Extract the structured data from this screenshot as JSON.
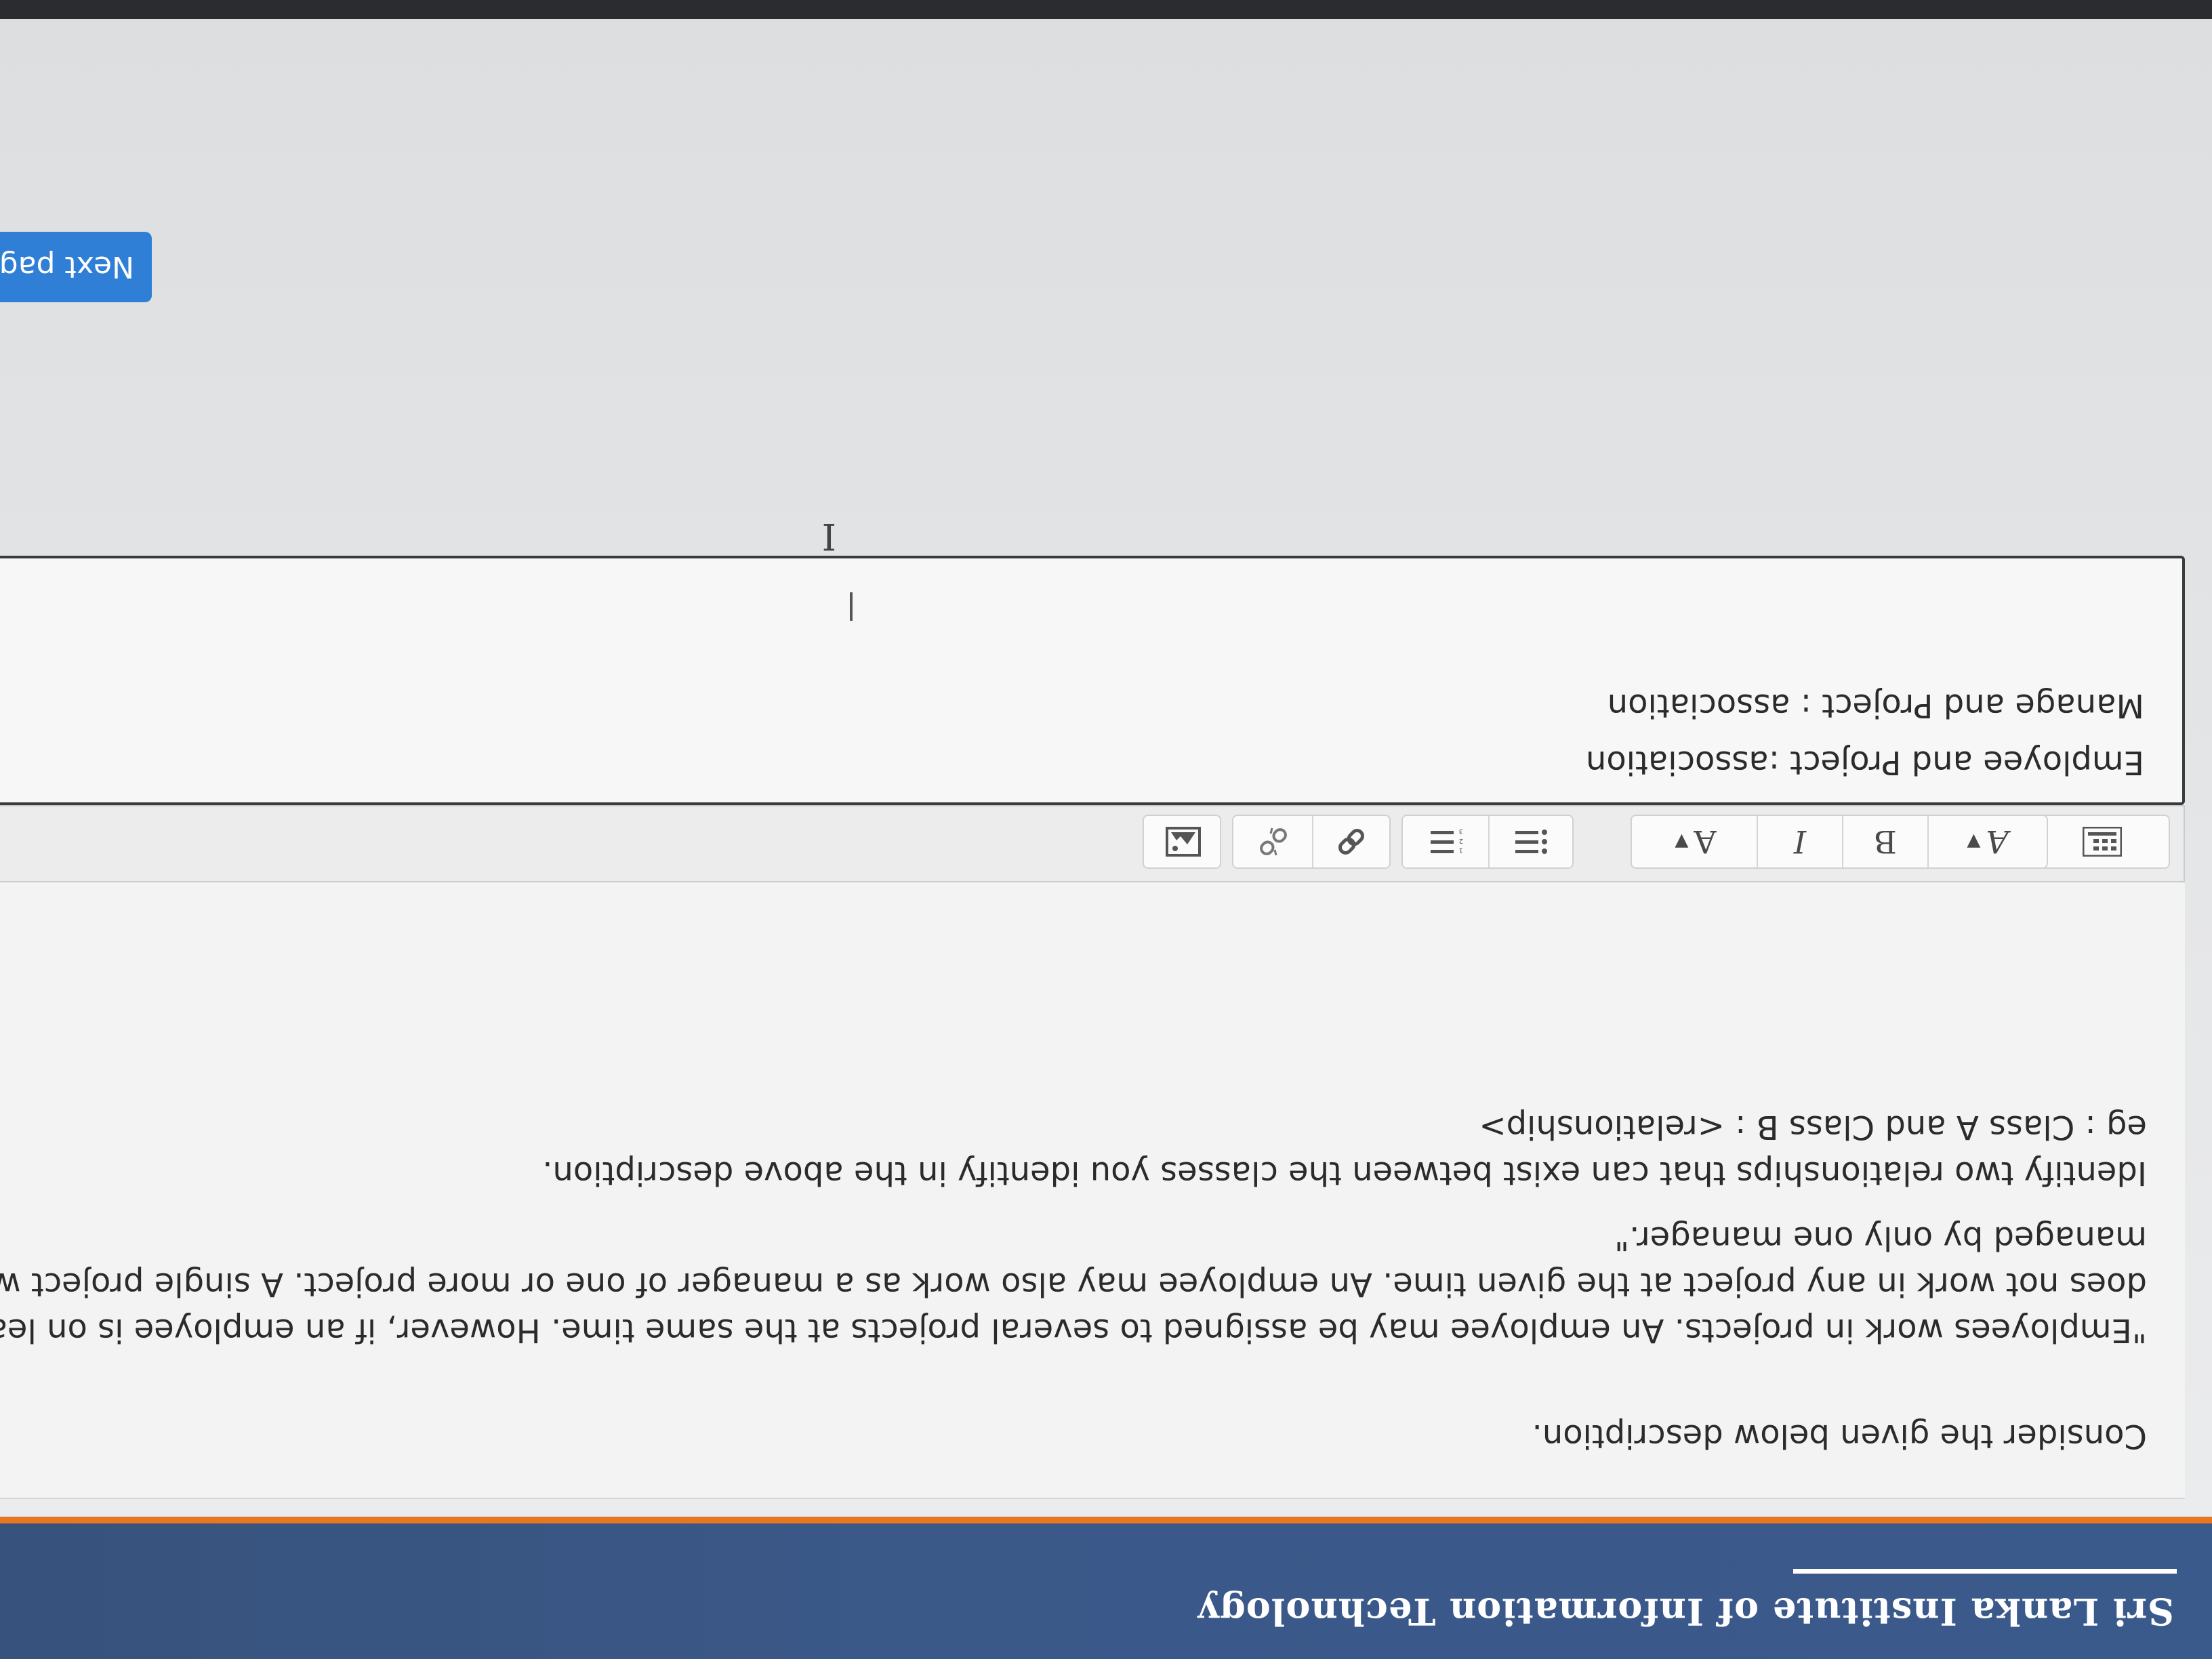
{
  "header": {
    "title": "Sri Lanka Institute of Information Technology"
  },
  "question": {
    "intro": "Consider the given below description.",
    "description_lines": [
      "\"Employees work in projects. An employee may be assigned to several projects at the same time. However, if an employee is on leave,",
      "does not work in any project at the given time. An employee may also work as a manager of one or more project. A single project will b",
      "managed by only one manager.\""
    ],
    "prompt": "Identify two relationships that can exist between the classes you identify in the above description.",
    "example": "eg :  Class A and Class B :  <relationship>"
  },
  "toolbar": {
    "paragraph_style": "A",
    "bold": "B",
    "italic": "I",
    "font_color": "A",
    "icons": [
      "paragraph-style-icon",
      "bold-icon",
      "italic-icon",
      "font-color-icon",
      "bullet-list-icon",
      "numbered-list-icon",
      "link-icon",
      "unlink-icon",
      "image-icon",
      "show-more-icon"
    ]
  },
  "answer": {
    "lines": [
      "Employee and Project :association",
      "Manage and Project : association"
    ]
  },
  "navigation": {
    "next_label": "Next pag"
  }
}
